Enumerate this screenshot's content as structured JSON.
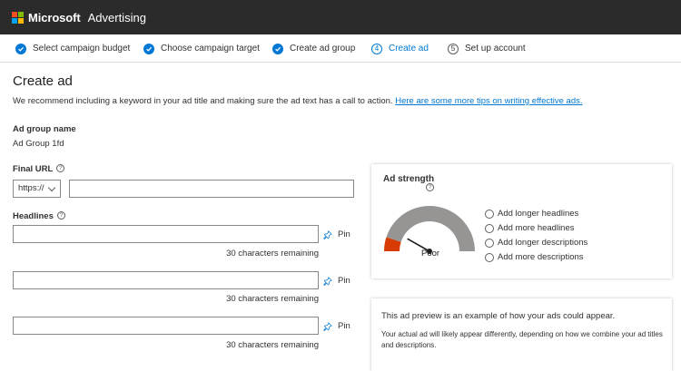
{
  "topbar": {
    "brand": "Microsoft",
    "product": "Advertising",
    "logo_colors": [
      "#f25022",
      "#7fba00",
      "#00a4ef",
      "#ffb900"
    ]
  },
  "steps": [
    {
      "label": "Select campaign budget",
      "state": "complete"
    },
    {
      "label": "Choose campaign target",
      "state": "complete"
    },
    {
      "label": "Create ad group",
      "state": "complete"
    },
    {
      "label": "Create ad",
      "number": "4",
      "state": "active"
    },
    {
      "label": "Set up account",
      "number": "5",
      "state": "pending"
    }
  ],
  "page": {
    "title": "Create ad",
    "intro_text": "We recommend including a keyword in your ad title and making sure the ad text has a call to action.",
    "intro_link": "Here are some more tips on writing effective ads."
  },
  "ad_group": {
    "label": "Ad group name",
    "value": "Ad Group 1fd"
  },
  "final_url": {
    "label": "Final URL",
    "help_icon": "?",
    "protocol_selected": "https://",
    "value": ""
  },
  "headlines": {
    "label": "Headlines",
    "help_icon": "?",
    "items": [
      {
        "value": "",
        "pin_label": "Pin",
        "remaining": "30 characters remaining"
      },
      {
        "value": "",
        "pin_label": "Pin",
        "remaining": "30 characters remaining"
      },
      {
        "value": "",
        "pin_label": "Pin",
        "remaining": "30 characters remaining"
      }
    ]
  },
  "ad_strength": {
    "title": "Ad strength",
    "help_icon": "?",
    "rating": "Poor",
    "level_fraction": 0.1,
    "colors": {
      "filled": "#d83b01",
      "track": "#979593"
    },
    "suggestions": [
      "Add longer headlines",
      "Add more headlines",
      "Add longer descriptions",
      "Add more descriptions"
    ]
  },
  "preview": {
    "heading": "This ad preview is an example of how your ads could appear.",
    "subtext": "Your actual ad will likely appear differently, depending on how we combine your ad titles and descriptions."
  },
  "accent_color": "#0078d4"
}
